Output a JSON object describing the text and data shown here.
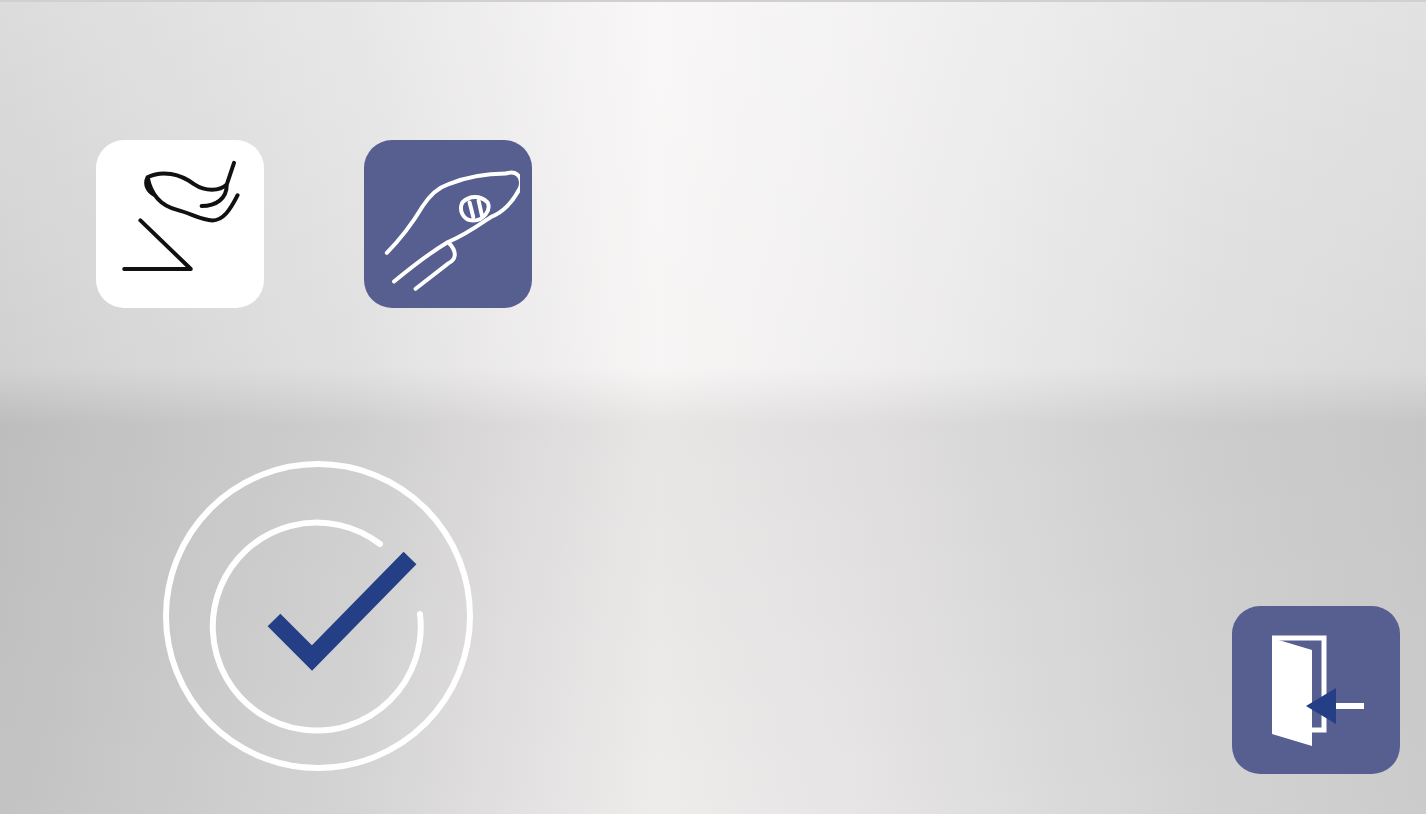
{
  "modes": [
    {
      "kind": "foot",
      "selected": false
    },
    {
      "kind": "hand",
      "selected": true
    }
  ]
}
